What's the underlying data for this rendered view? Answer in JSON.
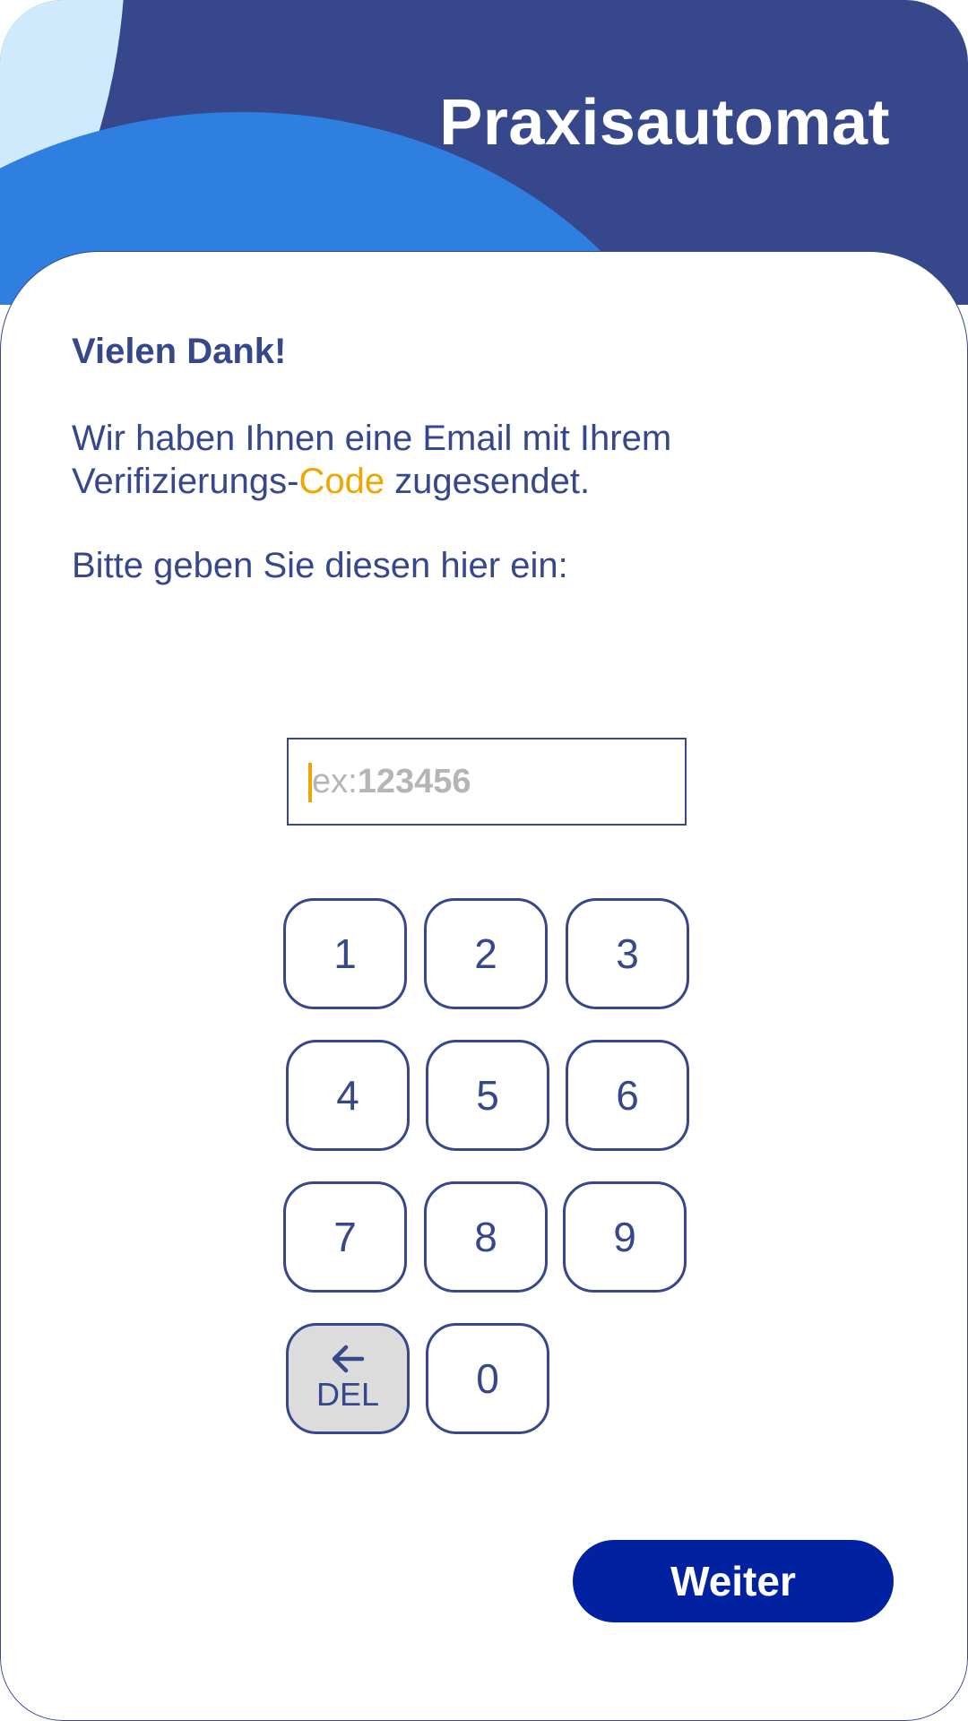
{
  "app": {
    "title": "Praxisautomat"
  },
  "message": {
    "greeting": "Vielen Dank!",
    "line1": "Wir haben Ihnen eine Email mit Ihrem",
    "line2_prefix": "Verifizierungs-",
    "line2_highlight": "Code",
    "line2_suffix": " zugesendet.",
    "prompt": "Bitte geben Sie diesen hier ein:"
  },
  "code_input": {
    "value": "",
    "placeholder_prefix": "ex:",
    "placeholder_example": "123456"
  },
  "keypad": {
    "keys": [
      "1",
      "2",
      "3",
      "4",
      "5",
      "6",
      "7",
      "8",
      "9",
      "0"
    ],
    "delete_label": "DEL"
  },
  "actions": {
    "next_label": "Weiter"
  },
  "colors": {
    "primary": "#36478c",
    "accent": "#f0a500",
    "button": "#0022a0",
    "delete_bg": "#dcdcdc"
  },
  "icons": {
    "delete": "arrow-left-icon"
  }
}
